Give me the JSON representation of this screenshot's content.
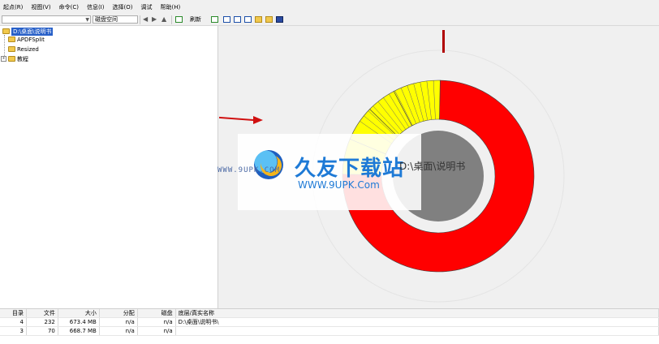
{
  "menu": [
    "起点(R)",
    "视图(V)",
    "命令(C)",
    "信息(I)",
    "选择(O)",
    "调试",
    "帮助(H)"
  ],
  "toolbar": {
    "space_label": "磁盘空间",
    "calc_label": "刷新"
  },
  "tree": {
    "root": "D:\\桌面\\说明书",
    "children": [
      "APDFSplit",
      "Resized",
      "教程"
    ]
  },
  "watermark": {
    "title": "久友下载站",
    "url": "WWW.9UPK.Com",
    "side_text": "WWW.9UPK.COM",
    "folder_text": "D:\\桌面\\说明书"
  },
  "chart_data": {
    "type": "pie",
    "title": "",
    "slices": [
      {
        "label": "",
        "fraction": 0.75,
        "color": "#ff0000"
      },
      {
        "label": "",
        "fraction": 0.06,
        "color": "#ffff00"
      },
      {
        "label": "",
        "fraction": 0.06,
        "color": "#ffff00"
      },
      {
        "label": "",
        "fraction": 0.05,
        "color": "#ffff00"
      },
      {
        "label": "",
        "fraction": 0.08,
        "color": "#ffff00"
      }
    ],
    "center_color": "#808080"
  },
  "table": {
    "headers": [
      "目录",
      "文件",
      "大小",
      "分配",
      "磁盘",
      "底层/真实名称"
    ],
    "rows": [
      [
        "4",
        "232",
        "673.4 MB",
        "n/a",
        "n/a",
        "D:\\桌面\\说明书\\"
      ],
      [
        "3",
        "70",
        "668.7 MB",
        "n/a",
        "n/a",
        ""
      ]
    ]
  }
}
